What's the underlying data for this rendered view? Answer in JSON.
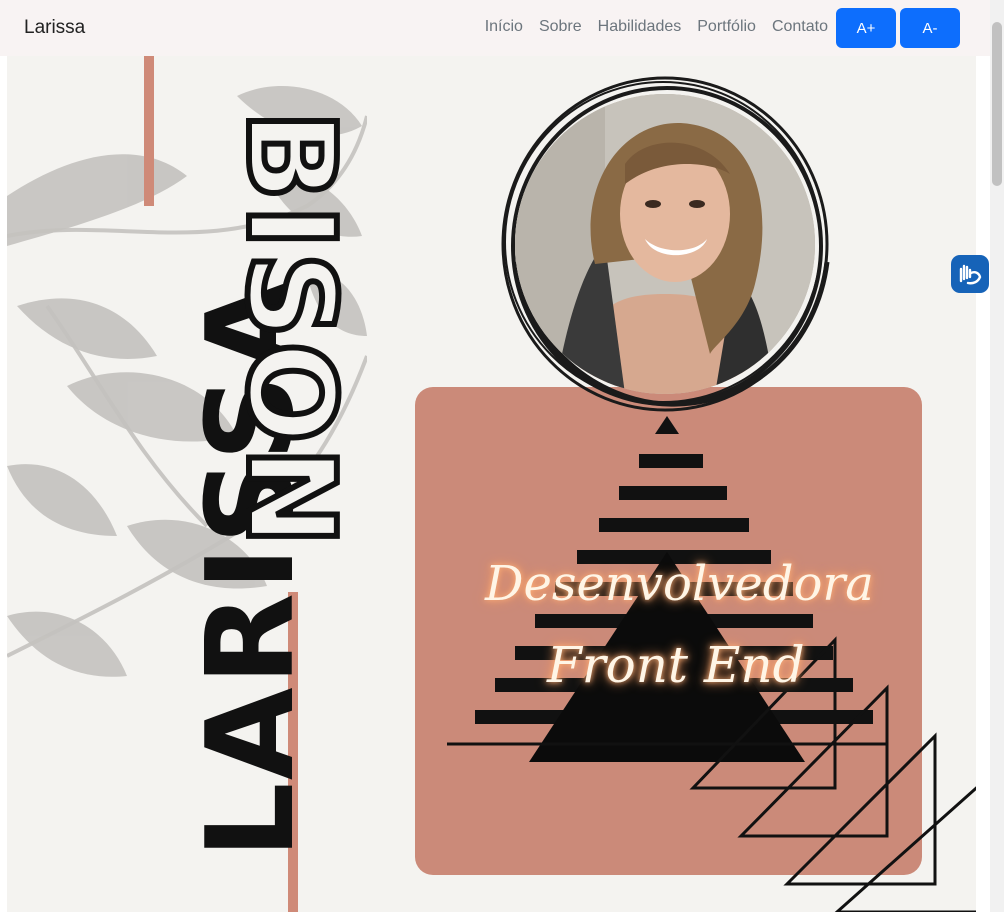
{
  "navbar": {
    "brand": "Larissa",
    "links": [
      "Início",
      "Sobre",
      "Habilidades",
      "Portfólio",
      "Contato"
    ],
    "font_increase": "A+",
    "font_decrease": "A-"
  },
  "hero": {
    "first_name": "LARISSA",
    "last_name": "BISON",
    "tagline_line1": "Desenvolvedora",
    "tagline_line2": "Front End"
  },
  "colors": {
    "accent_pink": "#cb8a79",
    "button_blue": "#0d6efd",
    "background": "#f4f3f0",
    "accessibility_blue": "#1663b8"
  },
  "icons": {
    "accessibility": "sign-language-hands-icon"
  }
}
